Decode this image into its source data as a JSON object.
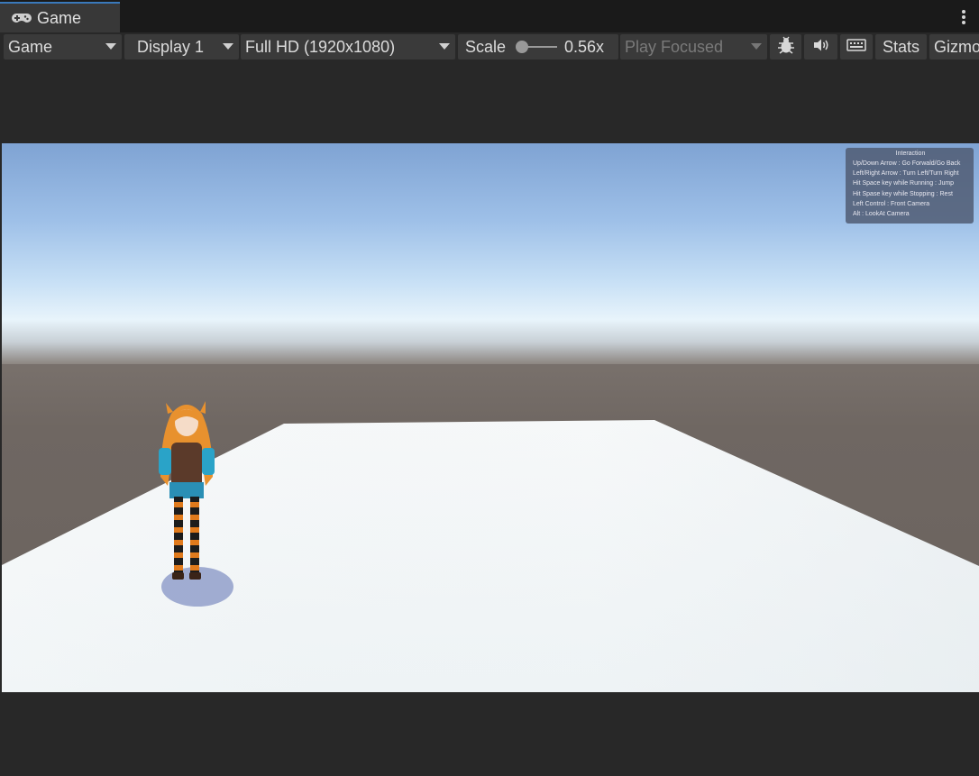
{
  "tab": {
    "title": "Game",
    "icon": "gamepad-icon"
  },
  "toolbar": {
    "game_dropdown": "Game",
    "display_dropdown": "Display 1",
    "resolution_dropdown": "Full HD (1920x1080)",
    "scale_label": "Scale",
    "scale_value": "0.56x",
    "scale_level": 0.56,
    "play_mode_dropdown": "Play Focused",
    "bug_icon": "bug-icon",
    "audio_icon": "speaker-icon",
    "keyboard_icon": "keyboard-icon",
    "stats_label": "Stats",
    "gizmos_label": "Gizmos"
  },
  "interaction_panel": {
    "title": "Interaction",
    "lines": [
      "Up/Down Arrow : Go Forwald/Go Back",
      "Left/Right Arrow : Turn Left/Turn Right",
      "Hit Space key while Running : Jump",
      "Hit Spase key while Stopping : Rest",
      "Left Control : Front Camera",
      "Alt : LookAt Camera"
    ]
  },
  "colors": {
    "tab_accent": "#3a79bb",
    "sky_top": "#7fa3d3",
    "ground": "#6a625e",
    "plane": "#f4f7f8"
  }
}
